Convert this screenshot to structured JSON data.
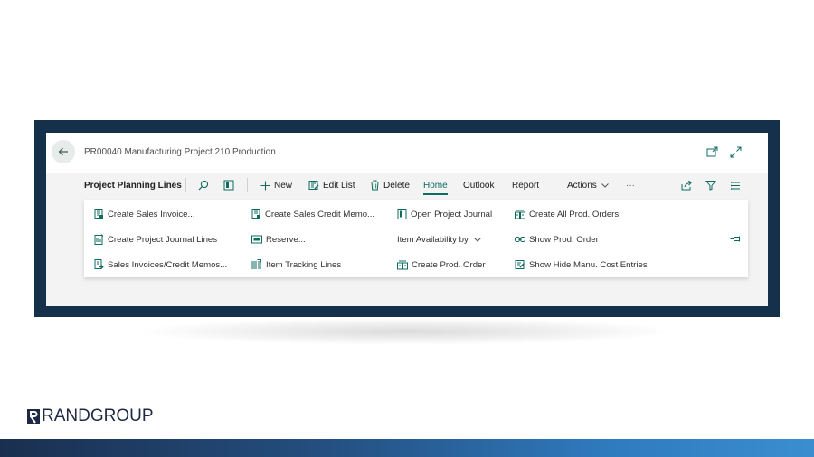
{
  "window": {
    "title": "PR00040 Manufacturing Project 210 Production"
  },
  "actionbar": {
    "section_label": "Project Planning Lines",
    "new_label": "New",
    "edit_list_label": "Edit List",
    "delete_label": "Delete",
    "tabs": [
      "Home",
      "Outlook",
      "Report"
    ],
    "actions_label": "Actions",
    "more_label": "···"
  },
  "panel": {
    "col1": [
      "Create Sales Invoice...",
      "Create Project Journal Lines",
      "Sales Invoices/Credit Memos..."
    ],
    "col2": [
      "Create Sales Credit Memo...",
      "Reserve...",
      "Item Tracking Lines"
    ],
    "col3": [
      "Open Project Journal",
      "Item Availability by",
      "Create Prod. Order"
    ],
    "col4": [
      "Create All Prod. Orders",
      "Show Prod. Order",
      "Show Hide Manu. Cost Entries"
    ]
  },
  "brand": {
    "logo_text": "RANDGROUP"
  },
  "colors": {
    "accent": "#0f6b5f",
    "frame": "#14304a",
    "icon": "#0f6b5f"
  }
}
